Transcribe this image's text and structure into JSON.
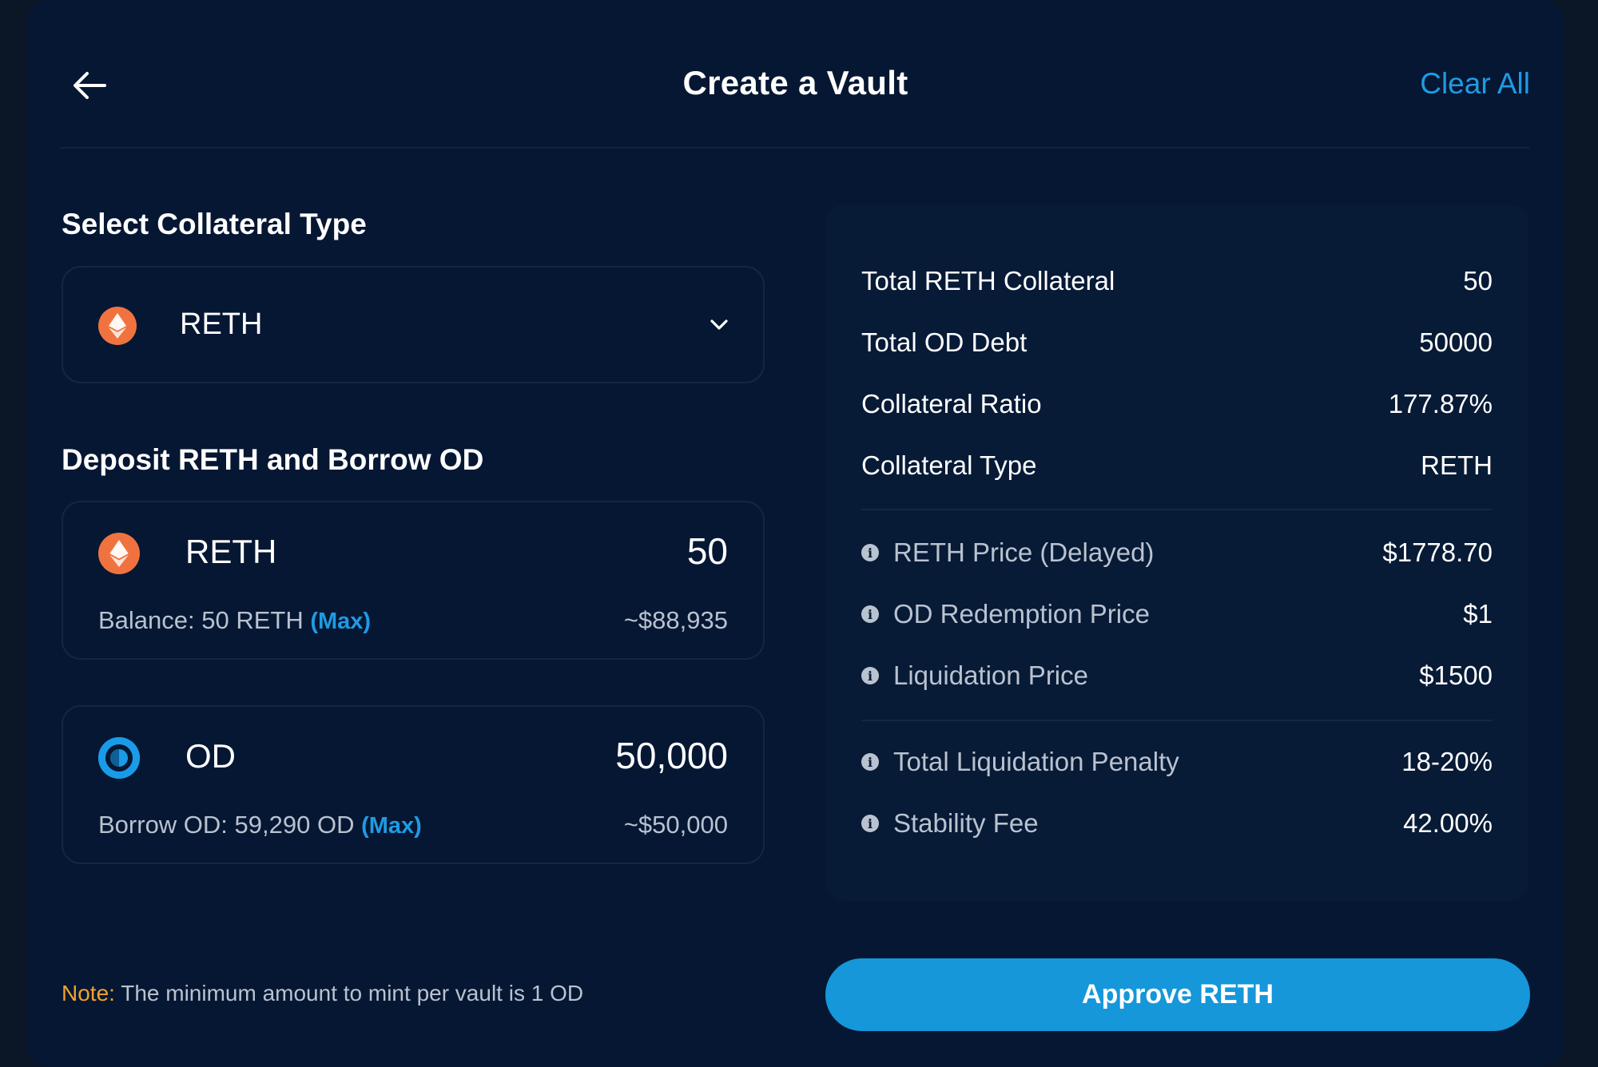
{
  "header": {
    "title": "Create a Vault",
    "clear_all": "Clear All"
  },
  "collateral_select": {
    "section_title": "Select Collateral Type",
    "selected": "RETH"
  },
  "deposit": {
    "section_title": "Deposit RETH and Borrow OD",
    "reth": {
      "token": "RETH",
      "amount": "50",
      "balance_text": "Balance: 50 RETH",
      "max_label": "(Max)",
      "usd_value": "~$88,935"
    },
    "od": {
      "token": "OD",
      "amount": "50,000",
      "borrow_text": "Borrow OD: 59,290 OD",
      "max_label": "(Max)",
      "usd_value": "~$50,000"
    }
  },
  "summary": {
    "rows": [
      {
        "label": "Total RETH Collateral",
        "value": "50"
      },
      {
        "label": "Total OD Debt",
        "value": "50000"
      },
      {
        "label": "Collateral Ratio",
        "value": "177.87%"
      },
      {
        "label": "Collateral Type",
        "value": "RETH"
      }
    ],
    "price_rows": [
      {
        "label": "RETH Price (Delayed)",
        "value": "$1778.70"
      },
      {
        "label": "OD Redemption Price",
        "value": "$1"
      },
      {
        "label": "Liquidation Price",
        "value": "$1500"
      }
    ],
    "fee_rows": [
      {
        "label": "Total Liquidation Penalty",
        "value": "18-20%"
      },
      {
        "label": "Stability Fee",
        "value": "42.00%"
      }
    ]
  },
  "note": {
    "label": "Note:",
    "text": "The minimum amount to mint per vault is 1 OD"
  },
  "approve_button": "Approve RETH",
  "colors": {
    "background": "#061733",
    "accent": "#1f9be3",
    "button": "#1597da",
    "note_label": "#f0a22e",
    "reth_icon": "#f0733f"
  },
  "icons": {
    "back": "arrow-left-icon",
    "dropdown": "chevron-down-icon",
    "reth": "reth-token-icon",
    "od": "od-token-icon",
    "info": "info-icon"
  }
}
